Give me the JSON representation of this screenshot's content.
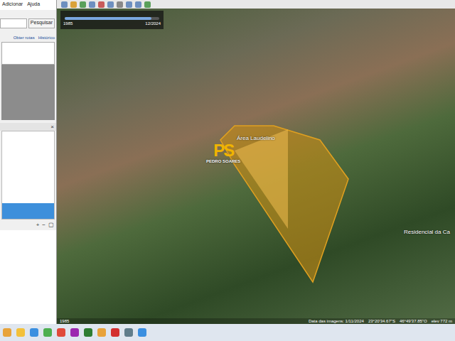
{
  "menu": [
    "Adicionar",
    "Ajuda"
  ],
  "search": {
    "button": "Pesquisar",
    "links": [
      "Obter rotas",
      "Histórico"
    ]
  },
  "panel": {
    "close": "×",
    "controls": [
      "+",
      "−",
      "▢"
    ]
  },
  "time_slider": {
    "start": "1985",
    "end": "12/2024",
    "level": 0.92
  },
  "map": {
    "labels": [
      {
        "text": "Área Laudelino"
      },
      {
        "text": "Residencial da Ca"
      }
    ],
    "watermark": {
      "logo": "PS",
      "name": "PEDRO SOARES"
    }
  },
  "status_bar": {
    "year": "1985",
    "date": "Data das imagens: 1/11/2024",
    "lat": "23°20'34.67\"S",
    "lon": "46°49'37.85\"O",
    "elev": "elev 772 m"
  }
}
